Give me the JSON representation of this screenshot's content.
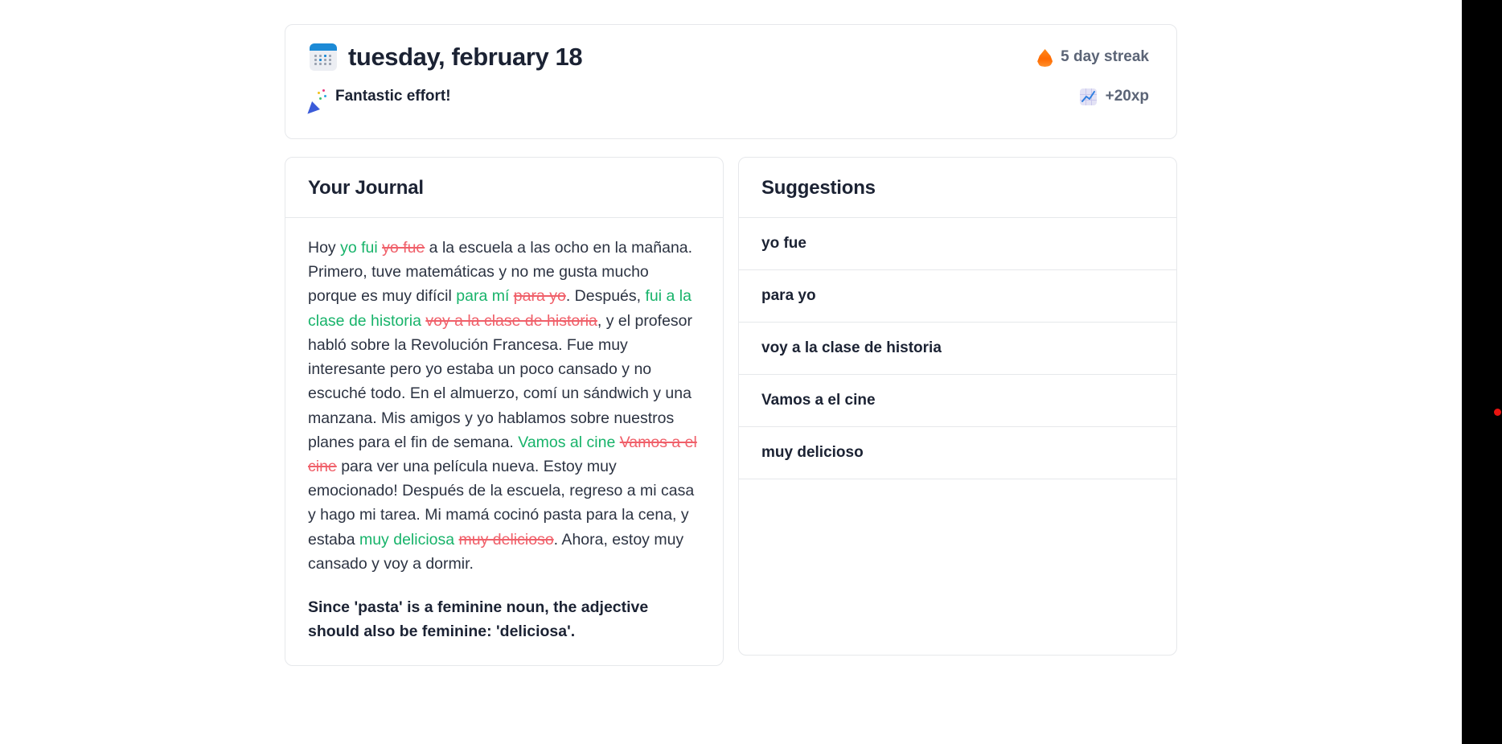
{
  "header": {
    "calendar_icon": "calendar-icon",
    "date": "tuesday, february 18",
    "streak_icon": "flame-icon",
    "streak": "5 day streak",
    "effort_icon": "party-popper-icon",
    "effort": "Fantastic effort!",
    "xp_icon": "chart-increasing-icon",
    "xp": "+20xp"
  },
  "journal": {
    "title": "Your Journal",
    "segments": [
      {
        "type": "plain",
        "text": "Hoy "
      },
      {
        "type": "correction",
        "text": "yo fui"
      },
      {
        "type": "plain",
        "text": " "
      },
      {
        "type": "error",
        "text": "yo fue"
      },
      {
        "type": "plain",
        "text": " a la escuela a las ocho en la mañana. Primero, tuve matemáticas y no me gusta mucho porque es muy difícil "
      },
      {
        "type": "correction",
        "text": "para mí"
      },
      {
        "type": "plain",
        "text": " "
      },
      {
        "type": "error",
        "text": "para yo"
      },
      {
        "type": "plain",
        "text": ". Después, "
      },
      {
        "type": "correction",
        "text": "fui a la clase de historia"
      },
      {
        "type": "plain",
        "text": " "
      },
      {
        "type": "error",
        "text": "voy a la clase de historia"
      },
      {
        "type": "plain",
        "text": ", y el profesor habló sobre la Revolución Francesa. Fue muy interesante pero yo estaba un poco cansado y no escuché todo. En el almuerzo, comí un sándwich y una manzana. Mis amigos y yo hablamos sobre nuestros planes para el fin de semana. "
      },
      {
        "type": "correction",
        "text": "Vamos al cine"
      },
      {
        "type": "plain",
        "text": " "
      },
      {
        "type": "error",
        "text": "Vamos a el cine"
      },
      {
        "type": "plain",
        "text": " para ver una película nueva. Estoy muy emocionado! Después de la escuela, regreso a mi casa y hago mi tarea. Mi mamá cocinó pasta para la cena, y estaba "
      },
      {
        "type": "correction",
        "text": "muy deliciosa"
      },
      {
        "type": "plain",
        "text": " "
      },
      {
        "type": "error",
        "text": "muy delicioso"
      },
      {
        "type": "plain",
        "text": ". Ahora, estoy muy cansado y voy a dormir."
      }
    ],
    "note": "Since 'pasta' is a feminine noun, the adjective should also be feminine: 'deliciosa'."
  },
  "suggestions": {
    "title": "Suggestions",
    "items": [
      {
        "label": "yo fue"
      },
      {
        "label": "para yo"
      },
      {
        "label": "voy a la clase de historia"
      },
      {
        "label": "Vamos a el cine"
      },
      {
        "label": "muy delicioso"
      }
    ]
  },
  "colors": {
    "correction": "#17b36a",
    "error": "#f0606a",
    "text": "#1b2233",
    "muted": "#5b6476",
    "border": "#e6e8eb",
    "gutter": "#000000",
    "gutter_dot": "#e81410"
  }
}
